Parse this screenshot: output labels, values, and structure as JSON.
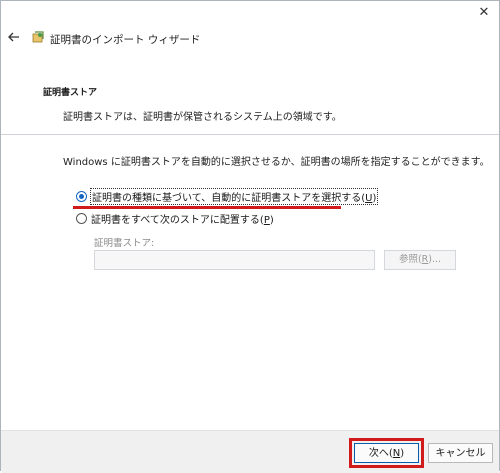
{
  "window": {
    "close_label": "✕"
  },
  "header": {
    "title": "証明書のインポート ウィザード",
    "back_icon": "back-arrow-icon",
    "app_icon": "certificate-wizard-icon"
  },
  "section": {
    "title": "証明書ストア",
    "description": "証明書ストアは、証明書が保管されるシステム上の領域です。"
  },
  "main": {
    "instruction": "Windows に証明書ストアを自動的に選択させるか、証明書の場所を指定することができます。",
    "options": [
      {
        "label": "証明書の種類に基づいて、自動的に証明書ストアを選択する(",
        "accel": "U",
        "tail": ")",
        "selected": true
      },
      {
        "label": "証明書をすべて次のストアに配置する(",
        "accel": "P",
        "tail": ")",
        "selected": false
      }
    ],
    "store_label": "証明書ストア:",
    "store_value": "",
    "browse_label": "参照(",
    "browse_accel": "R",
    "browse_tail": ")..."
  },
  "footer": {
    "next_label": "次へ(",
    "next_accel": "N",
    "next_tail": ")",
    "cancel_label": "キャンセル"
  },
  "colors": {
    "accent": "#1565c0",
    "highlight": "#d11b1b"
  }
}
